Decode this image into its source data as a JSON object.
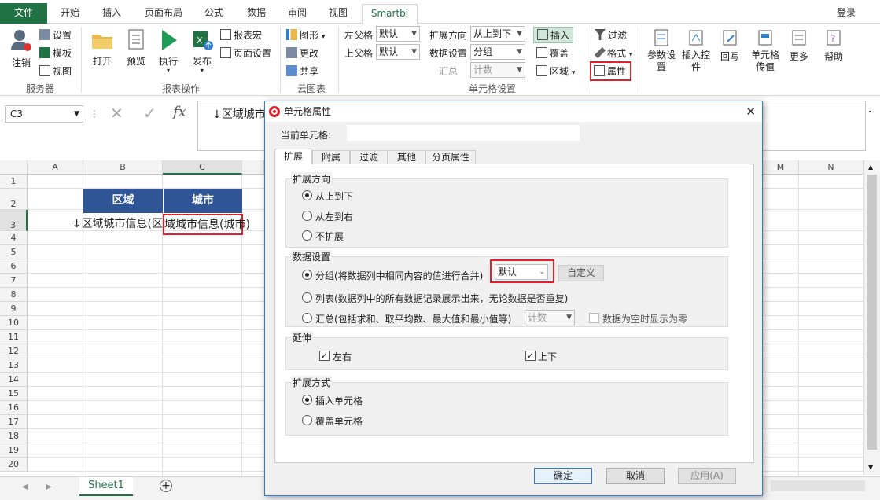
{
  "tabs": {
    "file": "文件",
    "home": "开始",
    "insert": "插入",
    "layout": "页面布局",
    "formula": "公式",
    "data": "数据",
    "review": "审阅",
    "view": "视图",
    "smartbi": "Smartbi",
    "login": "登录"
  },
  "ribbon": {
    "server": {
      "login": "注销",
      "settings": "设置",
      "template": "模板",
      "view": "视图",
      "group": "服务器"
    },
    "report_ops": {
      "open": "打开",
      "preview": "预览",
      "run": "执行",
      "publish": "发布",
      "macro": "报表宏",
      "page_setup": "页面设置",
      "group": "报表操作"
    },
    "cloud": {
      "chart": "图形",
      "update": "更改",
      "share": "共享",
      "group": "云图表"
    },
    "cell_settings": {
      "left_parent_label": "左父格",
      "left_parent_value": "默认",
      "top_parent_label": "上父格",
      "top_parent_value": "默认",
      "expand_dir_label": "扩展方向",
      "expand_dir_value": "从上到下",
      "data_settings_label": "数据设置",
      "data_settings_value": "分组",
      "summary_label": "汇总",
      "summary_value": "计数",
      "insert": "插入",
      "cover": "覆盖",
      "area": "区域",
      "group": "单元格设置"
    },
    "filter": "过滤",
    "format": "格式",
    "property": "属性",
    "param": "参数设置",
    "insert_ctrl": "插入控件",
    "write_back": "回写",
    "cell_pass": "单元格传值",
    "more": "更多",
    "help": "帮助"
  },
  "formula_bar": {
    "name_box": "C3",
    "content": "↓区域城市"
  },
  "sheet": {
    "columns": [
      "A",
      "B",
      "C",
      "M",
      "N"
    ],
    "rows": [
      "1",
      "2",
      "3",
      "4",
      "5",
      "6",
      "7",
      "8",
      "9",
      "10",
      "11",
      "12",
      "13",
      "14",
      "15",
      "16",
      "17",
      "18",
      "19",
      "20"
    ],
    "b2": "区域",
    "c2": "城市",
    "b3": "↓区域城市信息(区",
    "c3": "域城市信息(城市)",
    "sheet_tab": "Sheet1"
  },
  "dialog": {
    "title": "单元格属性",
    "current_cell_label": "当前单元格:",
    "tabs": [
      "扩展",
      "附属",
      "过滤",
      "其他",
      "分页属性"
    ],
    "expand_dir": {
      "legend": "扩展方向",
      "options": [
        "从上到下",
        "从左到右",
        "不扩展"
      ]
    },
    "data_settings": {
      "legend": "数据设置",
      "group": "分组(将数据列中相同内容的值进行合并)",
      "group_select": "默认",
      "custom": "自定义",
      "list": "列表(数据列中的所有数据记录展示出来，无论数据是否重复)",
      "summary": "汇总(包括求和、取平均数、最大值和最小值等)",
      "summary_select": "计数",
      "empty_zero": "数据为空时显示为零"
    },
    "extend": {
      "legend": "延伸",
      "lr": "左右",
      "ud": "上下"
    },
    "expand_mode": {
      "legend": "扩展方式",
      "options": [
        "插入单元格",
        "覆盖单元格"
      ]
    },
    "buttons": {
      "ok": "确定",
      "cancel": "取消",
      "apply": "应用(A)"
    }
  },
  "colors": {
    "excel_green": "#217346",
    "header_blue": "#2f5597",
    "highlight_red": "#e0202a"
  }
}
